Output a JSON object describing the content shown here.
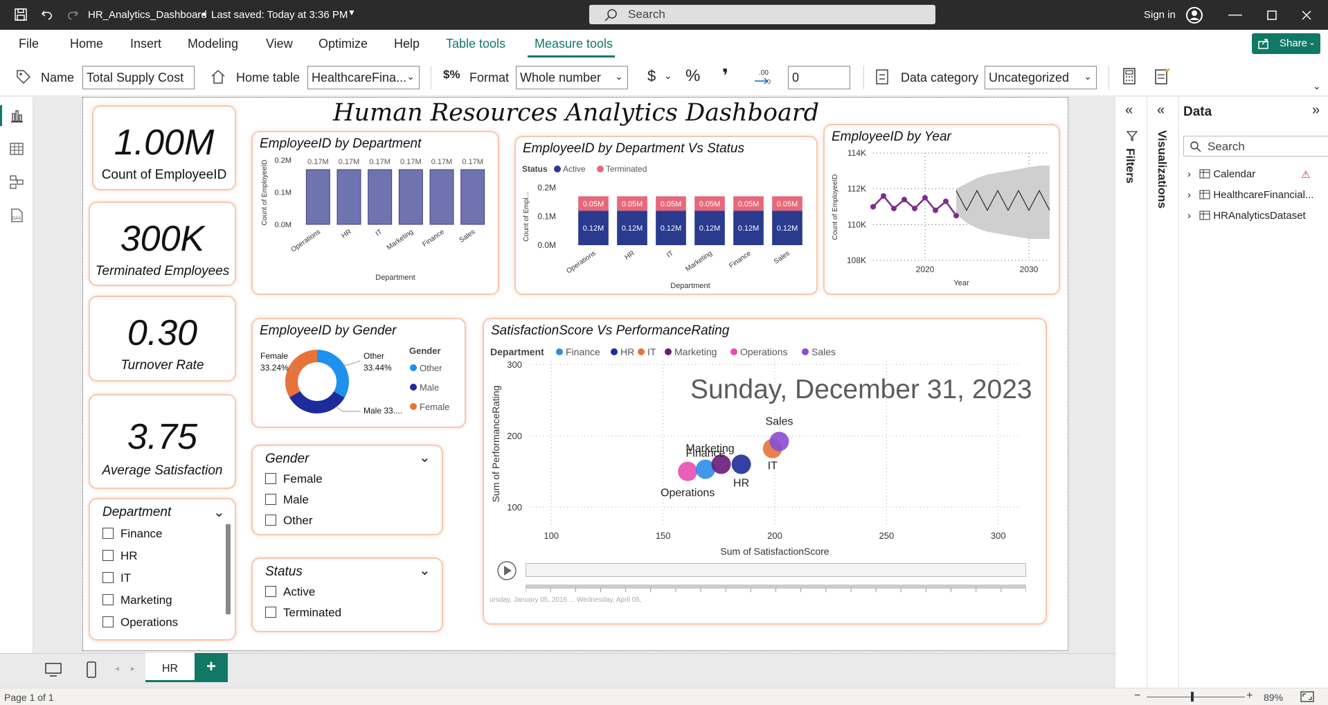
{
  "titlebar": {
    "file_name": "HR_Analytics_Dashboard",
    "saved": "Last saved: Today at 3:36 PM",
    "search_placeholder": "Search",
    "sign_in": "Sign in"
  },
  "ribbon_tabs": [
    "File",
    "Home",
    "Insert",
    "Modeling",
    "View",
    "Optimize",
    "Help",
    "Table tools",
    "Measure tools"
  ],
  "share_label": "Share",
  "ribbon": {
    "name_label": "Name",
    "name_value": "Total Supply Cost",
    "home_table_label": "Home table",
    "home_table_value": "HealthcareFina...",
    "format_label": "Format",
    "format_value": "Whole number",
    "currency_symbol": "$",
    "percent_symbol": "%",
    "comma_symbol": "❜",
    "decimals_value": "0",
    "data_category_label": "Data category",
    "data_category_value": "Uncategorized"
  },
  "report": {
    "title": "Human Resources Analytics Dashboard",
    "kpis": [
      {
        "value": "1.00M",
        "label": "Count of EmployeeID"
      },
      {
        "value": "300K",
        "label": "Terminated Employees"
      },
      {
        "value": "0.30",
        "label": "Turnover Rate"
      },
      {
        "value": "3.75",
        "label": "Average Satisfaction"
      }
    ],
    "slicers": {
      "department": {
        "title": "Department",
        "items": [
          "Finance",
          "HR",
          "IT",
          "Marketing",
          "Operations"
        ]
      },
      "gender": {
        "title": "Gender",
        "items": [
          "Female",
          "Male",
          "Other"
        ]
      },
      "status": {
        "title": "Status",
        "items": [
          "Active",
          "Terminated"
        ]
      }
    },
    "play_axis": {
      "date_display": "Sunday, December 31, 2023",
      "timeline_labels": "ursday, January 05, 2016 ... Wednesday, April 05,"
    }
  },
  "chart_data": [
    {
      "id": "dept",
      "type": "bar",
      "title": "EmployeeID by Department",
      "xlabel": "Department",
      "ylabel": "Count of EmployeeID",
      "categories": [
        "Operations",
        "HR",
        "IT",
        "Marketing",
        "Finance",
        "Sales"
      ],
      "values": [
        0.17,
        0.17,
        0.17,
        0.17,
        0.17,
        0.17
      ],
      "data_labels": [
        "0.17M",
        "0.17M",
        "0.17M",
        "0.17M",
        "0.17M",
        "0.17M"
      ],
      "yticks": [
        "0.0M",
        "0.1M",
        "0.2M"
      ],
      "ylim": [
        0,
        0.2
      ],
      "color": "#6f74b0"
    },
    {
      "id": "deptstatus",
      "type": "bar",
      "stacked": true,
      "title": "EmployeeID by Department Vs Status",
      "legend_title": "Status",
      "xlabel": "Department",
      "ylabel": "Count of Empl...",
      "categories": [
        "Operations",
        "HR",
        "IT",
        "Marketing",
        "Finance",
        "Sales"
      ],
      "series": [
        {
          "name": "Active",
          "color": "#2a3a8f",
          "values": [
            0.12,
            0.12,
            0.12,
            0.12,
            0.12,
            0.12
          ],
          "labels": [
            "0.12M",
            "0.12M",
            "0.12M",
            "0.12M",
            "0.12M",
            "0.12M"
          ]
        },
        {
          "name": "Terminated",
          "color": "#e8687a",
          "values": [
            0.05,
            0.05,
            0.05,
            0.05,
            0.05,
            0.05
          ],
          "labels": [
            "0.05M",
            "0.05M",
            "0.05M",
            "0.05M",
            "0.05M",
            "0.05M"
          ]
        }
      ],
      "yticks": [
        "0.0M",
        "0.1M",
        "0.2M"
      ],
      "ylim": [
        0,
        0.2
      ]
    },
    {
      "id": "year",
      "type": "line",
      "title": "EmployeeID by Year",
      "xlabel": "Year",
      "ylabel": "Count of EmployeeID",
      "x": [
        2015,
        2016,
        2017,
        2018,
        2019,
        2020,
        2021,
        2022,
        2023
      ],
      "values": [
        111000,
        111600,
        110900,
        111400,
        110900,
        111500,
        110800,
        111300,
        110500
      ],
      "forecast_x": [
        2023,
        2024,
        2025,
        2026,
        2027,
        2028,
        2029,
        2030,
        2031,
        2032
      ],
      "forecast": [
        111900,
        110800,
        111900,
        110800,
        111900,
        110800,
        111900,
        110800,
        111900,
        110800
      ],
      "band_upper": [
        112000,
        112300,
        112600,
        112800,
        112900,
        113000,
        113100,
        113200,
        113300,
        113300
      ],
      "band_lower": [
        110600,
        110100,
        109800,
        109600,
        109500,
        109400,
        109300,
        109200,
        109200,
        109200
      ],
      "ylim": [
        108000,
        114000
      ],
      "yticks": [
        "108K",
        "110K",
        "112K",
        "114K"
      ],
      "xticks": [
        "2020",
        "2030"
      ],
      "color": "#7b2d8e"
    },
    {
      "id": "gender",
      "type": "pie",
      "donut": true,
      "title": "EmployeeID by Gender",
      "legend_title": "Gender",
      "slices": [
        {
          "name": "Other",
          "value": 33.44,
          "label": "33.44%",
          "color": "#1e90ee"
        },
        {
          "name": "Male",
          "value": 33.32,
          "label": "Male 33....",
          "color": "#1e2b9a"
        },
        {
          "name": "Female",
          "value": 33.24,
          "label": "33.24%",
          "color": "#e8733a"
        }
      ]
    },
    {
      "id": "scatter",
      "type": "scatter",
      "title": "SatisfactionScore Vs PerformanceRating",
      "legend_title": "Department",
      "xlabel": "Sum of SatisfactionScore",
      "ylabel": "Sum of PerformanceRating",
      "xlim": [
        90,
        310
      ],
      "ylim": [
        75,
        305
      ],
      "xticks": [
        100,
        150,
        200,
        250,
        300
      ],
      "yticks": [
        100,
        200,
        300
      ],
      "points": [
        {
          "name": "Finance",
          "x": 169,
          "y": 153,
          "color": "#2a8de8"
        },
        {
          "name": "HR",
          "x": 185,
          "y": 160,
          "color": "#1e2b9a"
        },
        {
          "name": "IT",
          "x": 199,
          "y": 182,
          "color": "#e8733a"
        },
        {
          "name": "Marketing",
          "x": 176,
          "y": 160,
          "color": "#6a1a7a"
        },
        {
          "name": "Operations",
          "x": 161,
          "y": 150,
          "color": "#e84db2"
        },
        {
          "name": "Sales",
          "x": 202,
          "y": 192,
          "color": "#8a4dd0"
        }
      ]
    }
  ],
  "panes": {
    "filters": "Filters",
    "visualizations": "Visualizations",
    "data_title": "Data",
    "data_search": "Search",
    "data_items": [
      "Calendar",
      "HealthcareFinancial...",
      "HRAnalyticsDataset"
    ]
  },
  "pages": {
    "tabs": [
      "HR"
    ],
    "add": "+"
  },
  "status": {
    "page": "Page 1 of 1",
    "zoom": "89%"
  },
  "colors": {
    "accent": "#117865",
    "card_border": "#f7c7ad"
  }
}
